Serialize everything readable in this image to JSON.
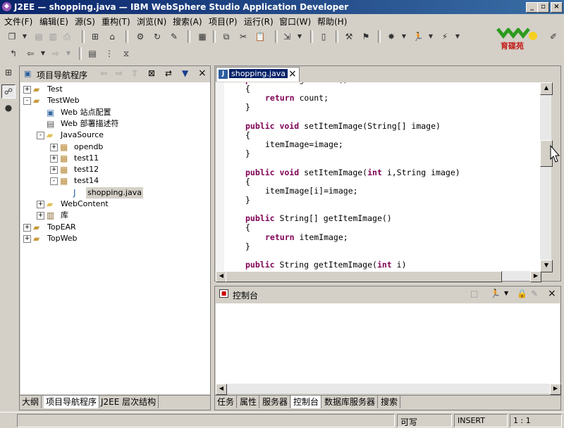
{
  "window": {
    "title": "J2EE — shopping.java — IBM WebSphere Studio Application Developer"
  },
  "logo_text": "育碟苑",
  "menu": [
    "文件(F)",
    "编辑(E)",
    "源(S)",
    "重构(T)",
    "浏览(N)",
    "搜索(A)",
    "项目(P)",
    "运行(R)",
    "窗口(W)",
    "帮助(H)"
  ],
  "navigator": {
    "title": "项目导航程序",
    "items": [
      {
        "label": "Test",
        "level": 0,
        "exp": "+",
        "icon": "project-icon"
      },
      {
        "label": "TestWeb",
        "level": 0,
        "exp": "-",
        "icon": "project-icon"
      },
      {
        "label": "Web 站点配置",
        "level": 1,
        "exp": "",
        "icon": "web-config-icon"
      },
      {
        "label": "Web 部署描述符",
        "level": 1,
        "exp": "",
        "icon": "descriptor-icon"
      },
      {
        "label": "JavaSource",
        "level": 1,
        "exp": "-",
        "icon": "folder-icon"
      },
      {
        "label": "opendb",
        "level": 2,
        "exp": "+",
        "icon": "package-icon"
      },
      {
        "label": "test11",
        "level": 2,
        "exp": "+",
        "icon": "package-icon"
      },
      {
        "label": "test12",
        "level": 2,
        "exp": "+",
        "icon": "package-icon"
      },
      {
        "label": "test14",
        "level": 2,
        "exp": "-",
        "icon": "package-icon"
      },
      {
        "label": "shopping.java",
        "level": 3,
        "exp": "",
        "icon": "java-file-icon",
        "selected": true
      },
      {
        "label": "WebContent",
        "level": 1,
        "exp": "+",
        "icon": "folder-icon"
      },
      {
        "label": "库",
        "level": 1,
        "exp": "+",
        "icon": "library-icon"
      },
      {
        "label": "TopEAR",
        "level": 0,
        "exp": "+",
        "icon": "project-icon"
      },
      {
        "label": "TopWeb",
        "level": 0,
        "exp": "+",
        "icon": "project-icon"
      }
    ],
    "bottom_tabs": [
      "大纲",
      "项目导航程序",
      "J2EE 层次结构"
    ]
  },
  "editor": {
    "tab": "shopping.java",
    "lines": [
      {
        "indent": 1,
        "parts": [
          [
            "kw",
            "public int "
          ],
          [
            "",
            "getCount()"
          ]
        ]
      },
      {
        "indent": 1,
        "parts": [
          [
            "",
            "{"
          ]
        ]
      },
      {
        "indent": 2,
        "parts": [
          [
            "kw",
            "return "
          ],
          [
            "",
            "count;"
          ]
        ]
      },
      {
        "indent": 1,
        "parts": [
          [
            "",
            "}"
          ]
        ]
      },
      {
        "indent": 0,
        "parts": []
      },
      {
        "indent": 1,
        "parts": [
          [
            "kw",
            "public void "
          ],
          [
            "",
            "setItemImage(String[] image)"
          ]
        ]
      },
      {
        "indent": 1,
        "parts": [
          [
            "",
            "{"
          ]
        ]
      },
      {
        "indent": 2,
        "parts": [
          [
            "",
            "itemImage=image;"
          ]
        ]
      },
      {
        "indent": 1,
        "parts": [
          [
            "",
            "}"
          ]
        ]
      },
      {
        "indent": 0,
        "parts": []
      },
      {
        "indent": 1,
        "parts": [
          [
            "kw",
            "public void "
          ],
          [
            "",
            "setItemImage("
          ],
          [
            "kw",
            "int "
          ],
          [
            "",
            "i,String image)"
          ]
        ]
      },
      {
        "indent": 1,
        "parts": [
          [
            "",
            "{"
          ]
        ]
      },
      {
        "indent": 2,
        "parts": [
          [
            "",
            "itemImage[i]=image;"
          ]
        ]
      },
      {
        "indent": 1,
        "parts": [
          [
            "",
            "}"
          ]
        ]
      },
      {
        "indent": 0,
        "parts": []
      },
      {
        "indent": 1,
        "parts": [
          [
            "kw",
            "public "
          ],
          [
            "",
            "String[] getItemImage()"
          ]
        ]
      },
      {
        "indent": 1,
        "parts": [
          [
            "",
            "{"
          ]
        ]
      },
      {
        "indent": 2,
        "parts": [
          [
            "kw",
            "return "
          ],
          [
            "",
            "itemImage;"
          ]
        ]
      },
      {
        "indent": 1,
        "parts": [
          [
            "",
            "}"
          ]
        ]
      },
      {
        "indent": 0,
        "parts": []
      },
      {
        "indent": 1,
        "parts": [
          [
            "kw",
            "public "
          ],
          [
            "",
            "String getItemImage("
          ],
          [
            "kw",
            "int "
          ],
          [
            "",
            "i)"
          ]
        ]
      }
    ]
  },
  "console": {
    "title": "控制台",
    "bottom_tabs": [
      "任务",
      "属性",
      "服务器",
      "控制台",
      "数据库服务器",
      "搜索"
    ]
  },
  "status": {
    "writable": "可写",
    "mode": "INSERT",
    "position": "1 : 1"
  }
}
